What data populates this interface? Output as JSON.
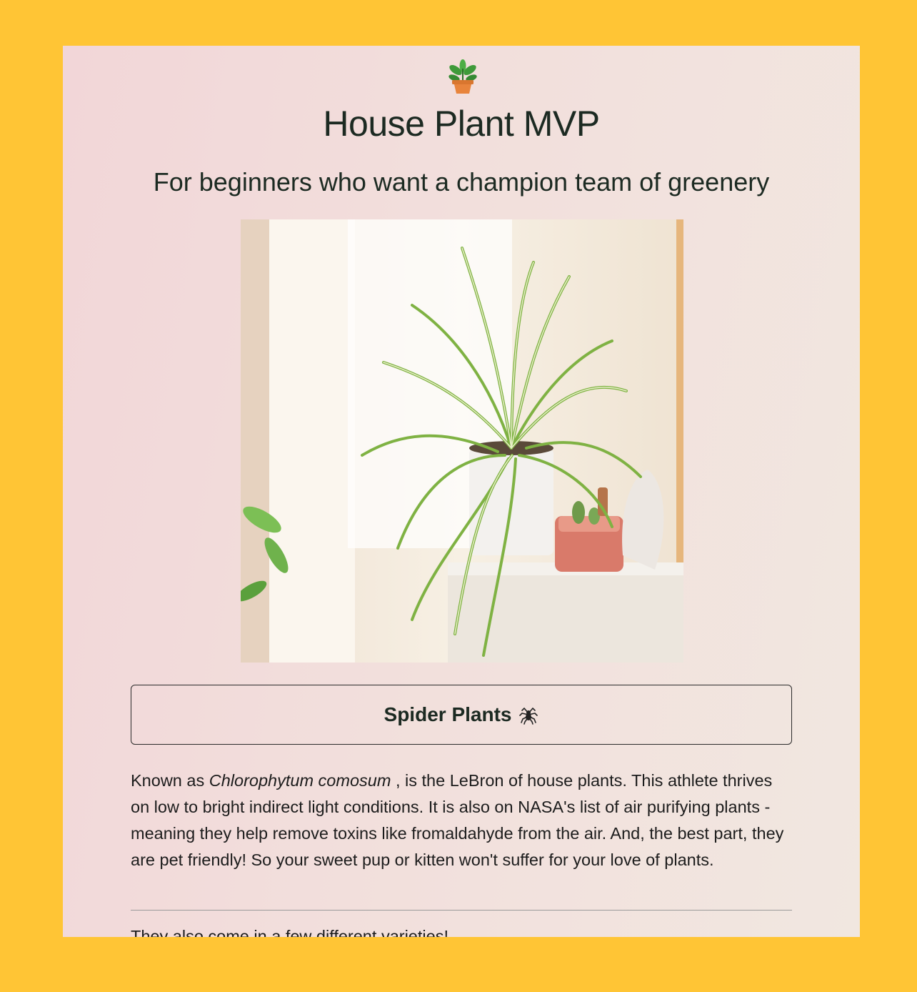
{
  "page": {
    "title": "House Plant MVP",
    "subtitle": "For beginners who want a champion team of greenery",
    "logo_icon": "potted-plant-icon",
    "hero_alt": "Spider plant in a white pot on a windowsill"
  },
  "plant_button": {
    "label": "Spider Plants",
    "icon": "spider-icon"
  },
  "description": {
    "prefix": "Known as ",
    "scientific_name": "Chlorophytum comosum",
    "body": " , is the LeBron of house plants. This athlete thrives on low to bright indirect light conditions. It is also on NASA's list of air purifying plants - meaning they help remove toxins like fromaldahyde from the air. And, the best part, they are pet friendly! So your sweet pup or kitten won't suffer for your love of plants."
  },
  "varieties_intro": "They also come in a few different varieties!",
  "colors": {
    "frame": "#FFC535",
    "text": "#1c2a22"
  }
}
